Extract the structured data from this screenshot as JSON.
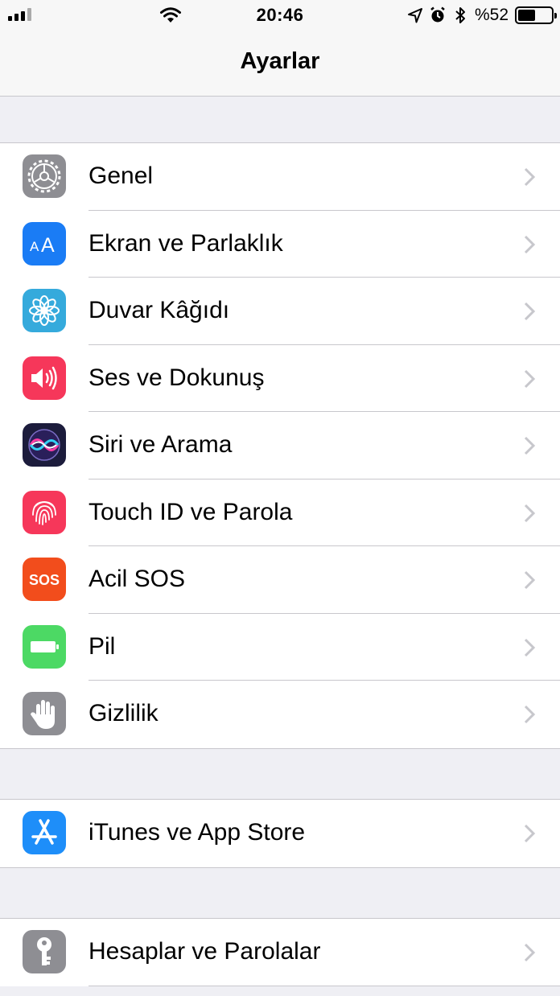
{
  "status_bar": {
    "time": "20:46",
    "battery_percent_text": "%52",
    "battery_level": 0.52
  },
  "nav": {
    "title": "Ayarlar"
  },
  "groups": [
    [
      {
        "label": "Genel",
        "icon": "gear-icon",
        "color": "#8e8e93"
      },
      {
        "label": "Ekran ve Parlaklık",
        "icon": "text-size-icon",
        "color": "#1a7cf5"
      },
      {
        "label": "Duvar Kâğıdı",
        "icon": "flower-icon",
        "color": "#35aadc"
      },
      {
        "label": "Ses ve Dokunuş",
        "icon": "speaker-icon",
        "color": "#f6375a"
      },
      {
        "label": "Siri ve Arama",
        "icon": "siri-icon",
        "color": "#1c1c3c"
      },
      {
        "label": "Touch ID ve Parola",
        "icon": "fingerprint-icon",
        "color": "#f6375a"
      },
      {
        "label": "Acil SOS",
        "icon": "sos-icon",
        "color": "#f24d1c",
        "icon_text": "SOS"
      },
      {
        "label": "Pil",
        "icon": "battery-icon",
        "color": "#4cd964"
      },
      {
        "label": "Gizlilik",
        "icon": "hand-icon",
        "color": "#8e8e93"
      }
    ],
    [
      {
        "label": "iTunes ve App Store",
        "icon": "app-store-icon",
        "color": "#1e8ef9"
      }
    ],
    [
      {
        "label": "Hesaplar ve Parolalar",
        "icon": "key-icon",
        "color": "#8e8e93"
      }
    ]
  ]
}
